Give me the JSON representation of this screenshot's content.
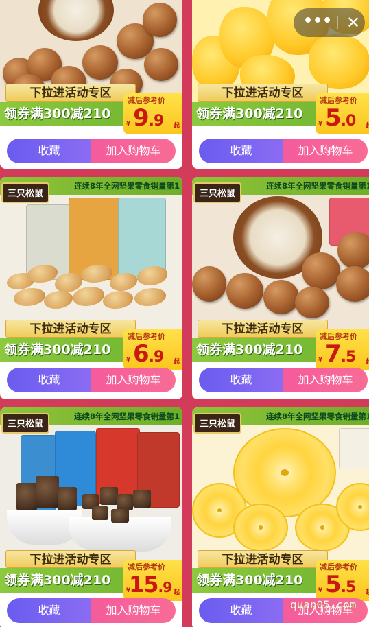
{
  "floating_menu": {
    "more_glyph": "•••",
    "close_glyph": "✕"
  },
  "promo_common": {
    "pull_down_text": "下拉进活动专区",
    "coupon_text": "领券满300减210",
    "price_label": "减后参考价",
    "price_currency": "¥",
    "price_unit": "起"
  },
  "brand": {
    "logo_text": "三只松鼠",
    "slogan": "连续8年全网坚果零食销量第1"
  },
  "buttons": {
    "favorite_label": "收藏",
    "cart_label": "加入购物车"
  },
  "products": [
    {
      "price_int": "9",
      "price_dec": ".9",
      "image": "macadamia-nuts"
    },
    {
      "price_int": "5",
      "price_dec": ".0",
      "image": "dried-mango"
    },
    {
      "price_int": "6",
      "price_dec": ".9",
      "image": "cashew-nuts"
    },
    {
      "price_int": "7",
      "price_dec": ".5",
      "image": "hazelnuts"
    },
    {
      "price_int": "15",
      "price_dec": ".9",
      "image": "beef-jerky"
    },
    {
      "price_int": "5",
      "price_dec": ".5",
      "image": "dried-pineapple"
    }
  ],
  "watermark": "quan05.com"
}
